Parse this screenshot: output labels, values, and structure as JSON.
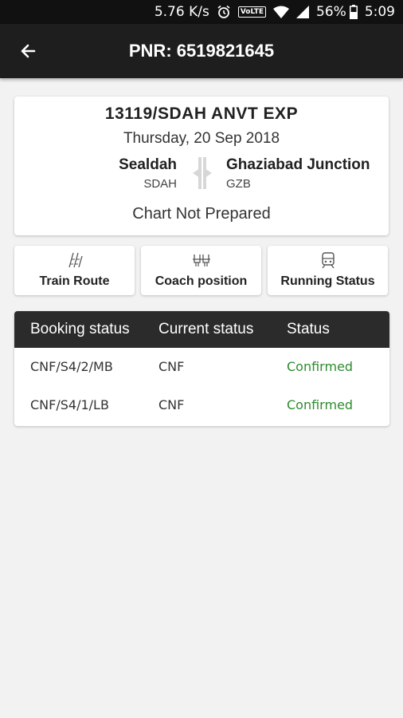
{
  "status_bar": {
    "speed": "5.76 K/s",
    "volte": "VoLTE",
    "battery": "56%",
    "time": "5:09",
    "icons": [
      "alarm-icon",
      "wifi-icon",
      "signal-icon",
      "battery-icon"
    ]
  },
  "app_bar": {
    "back_icon": "arrow-left-icon",
    "title": "PNR: 6519821645"
  },
  "train": {
    "name": "13119/SDAH  ANVT EXP",
    "date": "Thursday, 20 Sep 2018",
    "from_name": "Sealdah",
    "from_code": "SDAH",
    "to_name": "Ghaziabad Junction",
    "to_code": "GZB",
    "chart_status": "Chart Not Prepared"
  },
  "actions": [
    {
      "label": "Train Route",
      "icon": "train-route-icon"
    },
    {
      "label": "Coach position",
      "icon": "coach-position-icon"
    },
    {
      "label": "Running Status",
      "icon": "running-status-icon"
    }
  ],
  "table": {
    "headers": [
      "Booking status",
      "Current status",
      "Status"
    ],
    "rows": [
      {
        "booking": "CNF/S4/2/MB",
        "current": "CNF",
        "status": "Confirmed"
      },
      {
        "booking": "CNF/S4/1/LB",
        "current": "CNF",
        "status": "Confirmed"
      }
    ]
  },
  "colors": {
    "app_bar": "#1e1e1e",
    "table_header": "#2b2b2b",
    "confirmed": "#2e8b2e",
    "background": "#f2f2f2"
  }
}
